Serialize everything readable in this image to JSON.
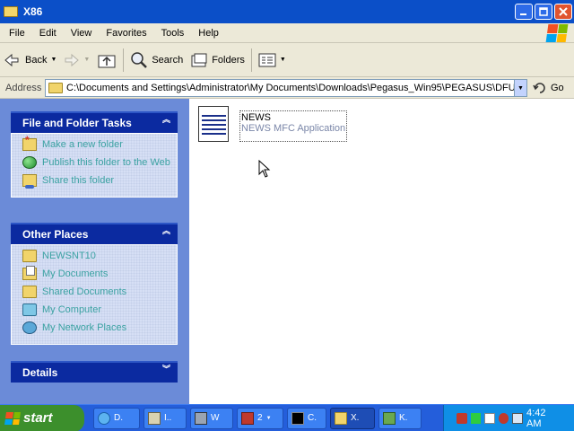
{
  "window": {
    "title": "X86",
    "buttons": [
      "minimize",
      "maximize",
      "close"
    ]
  },
  "menu": [
    "File",
    "Edit",
    "View",
    "Favorites",
    "Tools",
    "Help"
  ],
  "toolbar": {
    "back_label": "Back",
    "search_label": "Search",
    "folders_label": "Folders"
  },
  "address": {
    "label": "Address",
    "value": "C:\\Documents and Settings\\Administrator\\My Documents\\Downloads\\Pegasus_Win95\\PEGASUS\\DFUE\\N",
    "go_label": "Go"
  },
  "panels": {
    "tasks": {
      "title": "File and Folder Tasks",
      "items": [
        {
          "label": "Make a new folder",
          "icon": "new-folder-icon"
        },
        {
          "label": "Publish this folder to the Web",
          "icon": "globe-icon"
        },
        {
          "label": "Share this folder",
          "icon": "share-folder-icon"
        }
      ]
    },
    "places": {
      "title": "Other Places",
      "items": [
        {
          "label": "NEWSNT10",
          "icon": "folder-icon"
        },
        {
          "label": "My Documents",
          "icon": "documents-folder-icon"
        },
        {
          "label": "Shared Documents",
          "icon": "folder-icon"
        },
        {
          "label": "My Computer",
          "icon": "computer-icon"
        },
        {
          "label": "My Network Places",
          "icon": "network-icon"
        }
      ]
    },
    "details": {
      "title": "Details"
    }
  },
  "files": [
    {
      "name": "NEWS",
      "type": "NEWS MFC Application",
      "icon": "document-icon"
    }
  ],
  "taskbar": {
    "start_label": "start",
    "buttons": [
      {
        "label": "D.",
        "icon": "ie-icon"
      },
      {
        "label": "I..",
        "icon": "installer-icon"
      },
      {
        "label": "W",
        "icon": "monitor-icon"
      },
      {
        "label": "2",
        "icon": "app-group-icon"
      },
      {
        "label": "C.",
        "icon": "cmd-icon"
      },
      {
        "label": "X.",
        "icon": "folder-icon",
        "active": true
      },
      {
        "label": "K.",
        "icon": "network-app-icon"
      }
    ],
    "clock": "4:42 AM"
  },
  "colors": {
    "titlebar": "#0b4fc8",
    "sidepane": "#6b8bd8",
    "panel_header": "#0b2aa0",
    "link_text": "#3ba2a2",
    "taskbar": "#245edb",
    "start_button": "#3c8f2c",
    "tray": "#0f8fe6"
  }
}
